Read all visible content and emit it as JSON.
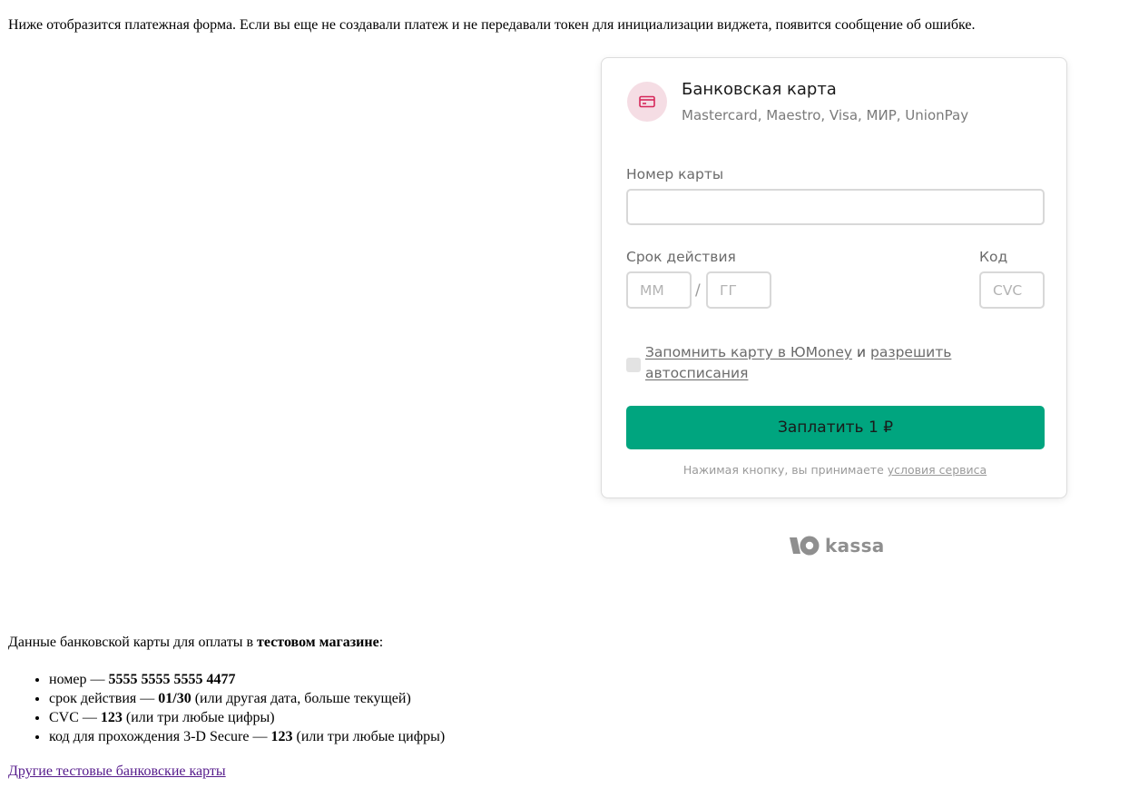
{
  "intro_text": "Ниже отобразится платежная форма. Если вы еще не создавали платеж и не передавали токен для инициализации виджета, появится сообщение об ошибке.",
  "widget": {
    "method_icon": "card-icon",
    "method_title": "Банковская карта",
    "method_subtitle": "Mastercard, Maestro, Visa, МИР, UnionPay",
    "card_number_label": "Номер карты",
    "card_number_value": "",
    "expiry_label": "Срок действия",
    "expiry_month_placeholder": "ММ",
    "expiry_year_placeholder": "ГГ",
    "expiry_separator": "/",
    "cvc_label": "Код",
    "cvc_placeholder": "CVC",
    "remember_checked": false,
    "remember_link_text": "Запомнить карту в ЮMoney",
    "remember_conjunction": "и",
    "autopay_link_text": "разрешить автосписания",
    "pay_button_label": "Заплатить 1 ₽",
    "terms_prefix": "Нажимая кнопку, вы принимаете",
    "terms_link_text": "условия сервиса",
    "accent_color": "#00a57f",
    "icon_bg_color": "#f5dde4",
    "icon_color": "#d6285a"
  },
  "brand": {
    "mark_icon": "yookassa-logo-mark",
    "wordmark": "kassa"
  },
  "test_info": {
    "intro_prefix": "Данные банковской карты для оплаты в",
    "intro_bold": "тестовом магазине",
    "intro_suffix": ":",
    "items": [
      {
        "prefix": "номер — ",
        "bold": "5555 5555 5555 4477",
        "suffix": ""
      },
      {
        "prefix": "срок действия — ",
        "bold": "01/30",
        "suffix": " (или другая дата, больше текущей)"
      },
      {
        "prefix": "CVC — ",
        "bold": "123",
        "suffix": " (или три любые цифры)"
      },
      {
        "prefix": "код для прохождения 3-D Secure — ",
        "bold": "123",
        "suffix": " (или три любые цифры)"
      }
    ],
    "more_link_text": "Другие тестовые банковские карты"
  }
}
